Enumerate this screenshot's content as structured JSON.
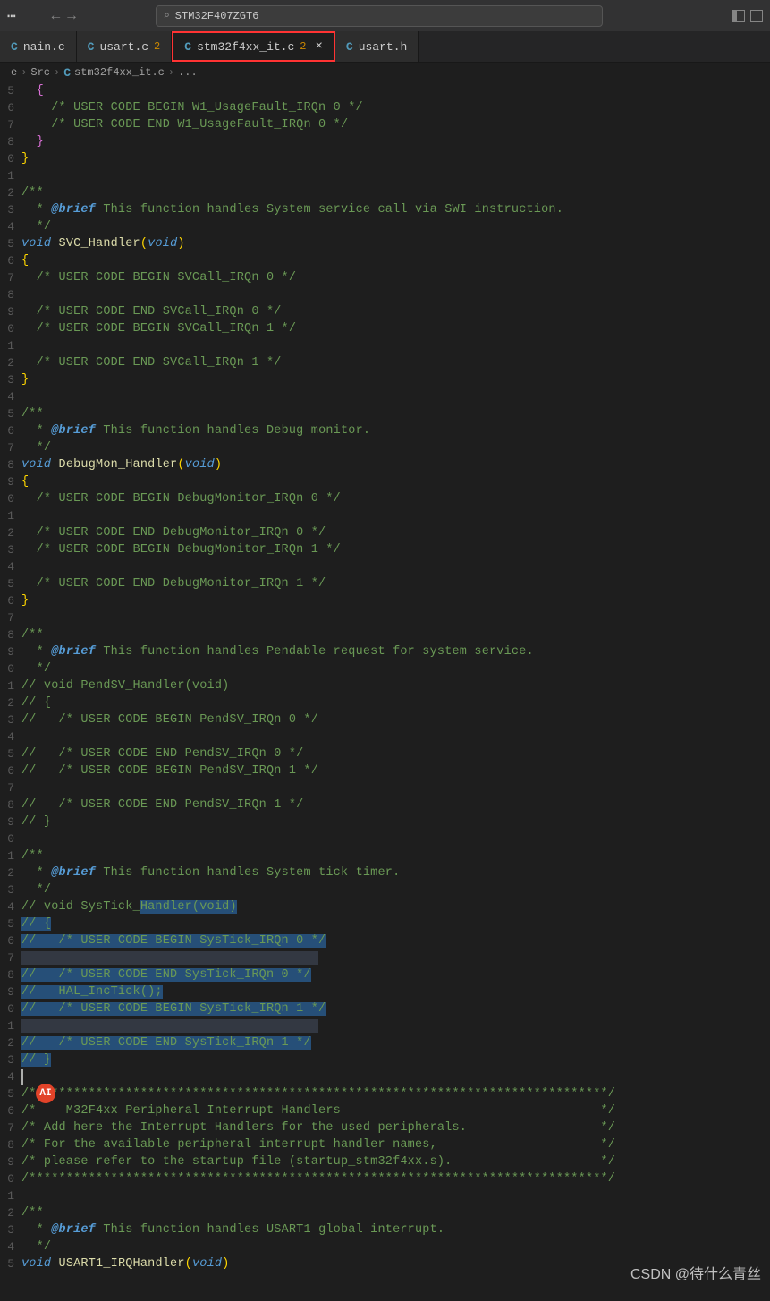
{
  "search": {
    "text": "STM32F407ZGT6"
  },
  "tabs": [
    {
      "icon": "C",
      "label": "nain.c",
      "badge": "",
      "close": false
    },
    {
      "icon": "C",
      "label": "usart.c",
      "badge": "2",
      "close": false
    },
    {
      "icon": "C",
      "label": "stm32f4xx_it.c",
      "badge": "2",
      "close": true,
      "active": true,
      "highlighted": true
    },
    {
      "icon": "C",
      "label": "usart.h",
      "badge": "",
      "close": false
    }
  ],
  "breadcrumb": {
    "p1": "e",
    "p2": "Src",
    "icon": "C",
    "p3": "stm32f4xx_it.c",
    "p4": "..."
  },
  "lines": [
    {
      "n": "5",
      "t": "  {",
      "cls": "c-brace-purple"
    },
    {
      "n": "6",
      "t": "    /* USER CODE BEGIN W1_UsageFault_IRQn 0 */",
      "cls": "c-comment"
    },
    {
      "n": "7",
      "t": "    /* USER CODE END W1_UsageFault_IRQn 0 */",
      "cls": "c-comment"
    },
    {
      "n": "8",
      "t": "  }",
      "cls": "c-brace-purple"
    },
    {
      "n": "0",
      "t": "}",
      "cls": "c-brace-yellow"
    },
    {
      "n": "1",
      "t": ""
    },
    {
      "n": "2",
      "t": "/**",
      "cls": "c-comment"
    },
    {
      "n": "3",
      "brief": true,
      "bt": "This function handles System service call via SWI instruction."
    },
    {
      "n": "4",
      "t": "  */",
      "cls": "c-comment"
    },
    {
      "n": "5",
      "sig": true,
      "kw": "void",
      "fn": "SVC_Handler",
      "pt": "void"
    },
    {
      "n": "6",
      "t": "{",
      "cls": "c-brace-yellow"
    },
    {
      "n": "7",
      "t": "  /* USER CODE BEGIN SVCall_IRQn 0 */",
      "cls": "c-comment"
    },
    {
      "n": "8",
      "t": ""
    },
    {
      "n": "9",
      "t": "  /* USER CODE END SVCall_IRQn 0 */",
      "cls": "c-comment"
    },
    {
      "n": "0",
      "t": "  /* USER CODE BEGIN SVCall_IRQn 1 */",
      "cls": "c-comment"
    },
    {
      "n": "1",
      "t": ""
    },
    {
      "n": "2",
      "t": "  /* USER CODE END SVCall_IRQn 1 */",
      "cls": "c-comment"
    },
    {
      "n": "3",
      "t": "}",
      "cls": "c-brace-yellow"
    },
    {
      "n": "4",
      "t": ""
    },
    {
      "n": "5",
      "t": "/**",
      "cls": "c-comment"
    },
    {
      "n": "6",
      "brief": true,
      "bt": "This function handles Debug monitor."
    },
    {
      "n": "7",
      "t": "  */",
      "cls": "c-comment"
    },
    {
      "n": "8",
      "sig": true,
      "kw": "void",
      "fn": "DebugMon_Handler",
      "pt": "void"
    },
    {
      "n": "9",
      "t": "{",
      "cls": "c-brace-yellow"
    },
    {
      "n": "0",
      "t": "  /* USER CODE BEGIN DebugMonitor_IRQn 0 */",
      "cls": "c-comment"
    },
    {
      "n": "1",
      "t": ""
    },
    {
      "n": "2",
      "t": "  /* USER CODE END DebugMonitor_IRQn 0 */",
      "cls": "c-comment"
    },
    {
      "n": "3",
      "t": "  /* USER CODE BEGIN DebugMonitor_IRQn 1 */",
      "cls": "c-comment"
    },
    {
      "n": "4",
      "t": ""
    },
    {
      "n": "5",
      "t": "  /* USER CODE END DebugMonitor_IRQn 1 */",
      "cls": "c-comment"
    },
    {
      "n": "6",
      "t": "}",
      "cls": "c-brace-yellow"
    },
    {
      "n": "7",
      "t": ""
    },
    {
      "n": "8",
      "t": "/**",
      "cls": "c-comment"
    },
    {
      "n": "9",
      "brief": true,
      "bt": "This function handles Pendable request for system service."
    },
    {
      "n": "0",
      "t": "  */",
      "cls": "c-comment"
    },
    {
      "n": "1",
      "t": "// void PendSV_Handler(void)",
      "cls": "c-comment"
    },
    {
      "n": "2",
      "t": "// {",
      "cls": "c-comment"
    },
    {
      "n": "3",
      "t": "//   /* USER CODE BEGIN PendSV_IRQn 0 */",
      "cls": "c-comment"
    },
    {
      "n": "4",
      "t": ""
    },
    {
      "n": "5",
      "t": "//   /* USER CODE END PendSV_IRQn 0 */",
      "cls": "c-comment"
    },
    {
      "n": "6",
      "t": "//   /* USER CODE BEGIN PendSV_IRQn 1 */",
      "cls": "c-comment"
    },
    {
      "n": "7",
      "t": ""
    },
    {
      "n": "8",
      "t": "//   /* USER CODE END PendSV_IRQn 1 */",
      "cls": "c-comment"
    },
    {
      "n": "9",
      "t": "// }",
      "cls": "c-comment"
    },
    {
      "n": "0",
      "t": ""
    },
    {
      "n": "1",
      "t": "/**",
      "cls": "c-comment"
    },
    {
      "n": "2",
      "brief": true,
      "bt": "This function handles System tick timer."
    },
    {
      "n": "3",
      "t": "  */",
      "cls": "c-comment"
    },
    {
      "n": "4",
      "mixhl": true,
      "pre": "// void SysTick_",
      "hl": "Handler(void)"
    },
    {
      "n": "5",
      "hl": true,
      "t": "// {"
    },
    {
      "n": "6",
      "hl": true,
      "t": "//   /* USER CODE BEGIN SysTick_IRQn 0 */"
    },
    {
      "n": "7",
      "hlcursor": true,
      "t": "                                        "
    },
    {
      "n": "8",
      "hl": true,
      "t": "//   /* USER CODE END SysTick_IRQn 0 */"
    },
    {
      "n": "9",
      "hl": true,
      "t": "//   HAL_IncTick();"
    },
    {
      "n": "0",
      "hl": true,
      "t": "//   /* USER CODE BEGIN SysTick_IRQn 1 */"
    },
    {
      "n": "1",
      "hlcursor": true,
      "t": "                                        "
    },
    {
      "n": "2",
      "hl": true,
      "t": "//   /* USER CODE END SysTick_IRQn 1 */"
    },
    {
      "n": "3",
      "hl": true,
      "t": "// }"
    },
    {
      "n": "4",
      "cursor": true,
      "t": ""
    },
    {
      "n": "5",
      "ai": true,
      "t": "/******************************************************************************/",
      "cls": "c-comment"
    },
    {
      "n": "6",
      "t": "/*    M32F4xx Peripheral Interrupt Handlers                                   */",
      "cls": "c-comment"
    },
    {
      "n": "7",
      "t": "/* Add here the Interrupt Handlers for the used peripherals.                  */",
      "cls": "c-comment"
    },
    {
      "n": "8",
      "t": "/* For the available peripheral interrupt handler names,                      */",
      "cls": "c-comment"
    },
    {
      "n": "9",
      "t": "/* please refer to the startup file (startup_stm32f4xx.s).                    */",
      "cls": "c-comment"
    },
    {
      "n": "0",
      "t": "/******************************************************************************/",
      "cls": "c-comment"
    },
    {
      "n": "1",
      "t": ""
    },
    {
      "n": "2",
      "t": "/**",
      "cls": "c-comment"
    },
    {
      "n": "3",
      "brief": true,
      "bt": "This function handles USART1 global interrupt."
    },
    {
      "n": "4",
      "t": "  */",
      "cls": "c-comment"
    },
    {
      "n": "5",
      "sig": true,
      "kw": "void",
      "fn": "USART1_IRQHandler",
      "pt": "void"
    }
  ],
  "watermark": "CSDN @待什么青丝"
}
